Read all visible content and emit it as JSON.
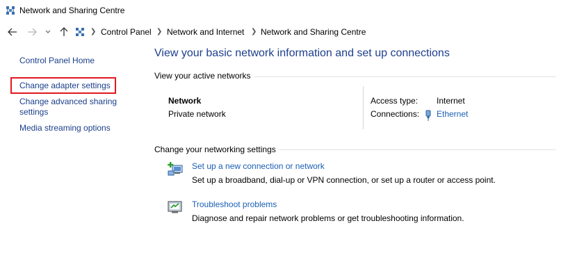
{
  "window": {
    "title": "Network and Sharing Centre"
  },
  "breadcrumb": [
    "Control Panel",
    "Network and Internet",
    "Network and Sharing Centre"
  ],
  "sidebar": {
    "items": [
      {
        "label": "Control Panel Home"
      },
      {
        "label": "Change adapter settings"
      },
      {
        "label": "Change advanced sharing settings"
      },
      {
        "label": "Media streaming options"
      }
    ]
  },
  "main": {
    "heading": "View your basic network information and set up connections",
    "active_networks": {
      "header": "View your active networks",
      "network_name": "Network",
      "network_type": "Private network",
      "access_type_label": "Access type:",
      "access_type_value": "Internet",
      "connections_label": "Connections:",
      "connections_value": "Ethernet"
    },
    "networking_settings": {
      "header": "Change your networking settings",
      "tasks": [
        {
          "link": "Set up a new connection or network",
          "description": "Set up a broadband, dial-up or VPN connection, or set up a router or access point.",
          "icon": "new-connection-icon"
        },
        {
          "link": "Troubleshoot problems",
          "description": "Diagnose and repair network problems or get troubleshooting information.",
          "icon": "troubleshoot-icon"
        }
      ]
    }
  },
  "colors": {
    "link": "#1a5fb4",
    "heading": "#1e3f8c",
    "highlight": "#e0191f"
  }
}
